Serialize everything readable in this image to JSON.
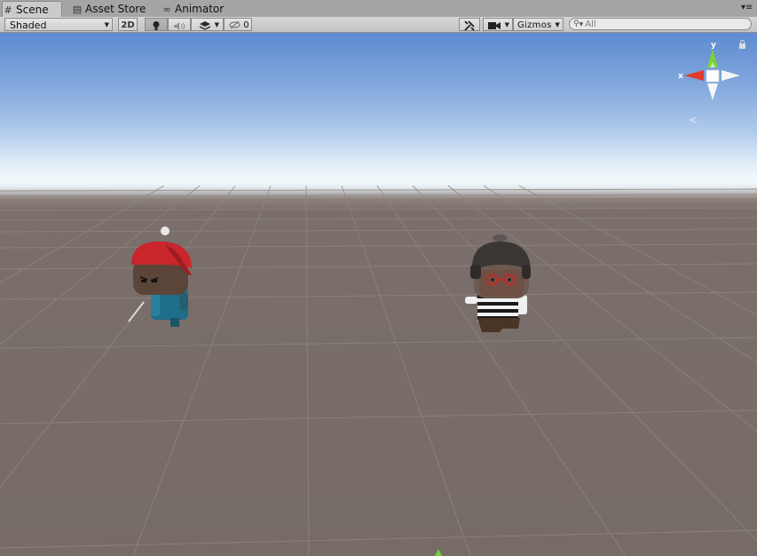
{
  "tabs": [
    {
      "label": "Scene",
      "icon": "hash-icon",
      "active": true
    },
    {
      "label": "Asset Store",
      "icon": "shopping-bag-icon",
      "active": false
    },
    {
      "label": "Animator",
      "icon": "animator-nodes-icon",
      "active": false
    }
  ],
  "toolbar": {
    "draw_mode": "Shaded",
    "mode_2d_label": "2D",
    "hidden_count": "0",
    "gizmos_label": "Gizmos",
    "search_placeholder": "All"
  },
  "gizmo": {
    "y_label": "y",
    "x_label": "x",
    "colors": {
      "x": "#e33b2e",
      "y": "#7bd23a",
      "z": "#ffffff"
    }
  },
  "icons": {
    "light": "lightbulb-icon",
    "audio": "speaker-icon",
    "effects": "layers-icon",
    "hidden": "eye-crossed-icon",
    "tools": "wrench-icon",
    "camera": "camera-icon",
    "search": "search-icon",
    "menu": "context-menu-icon",
    "lock": "lock-icon"
  },
  "colors": {
    "sky_top": "#5d8bd0",
    "horizon": "#f2f8fb",
    "ground": "#766b67",
    "grid": "#8d8581"
  }
}
